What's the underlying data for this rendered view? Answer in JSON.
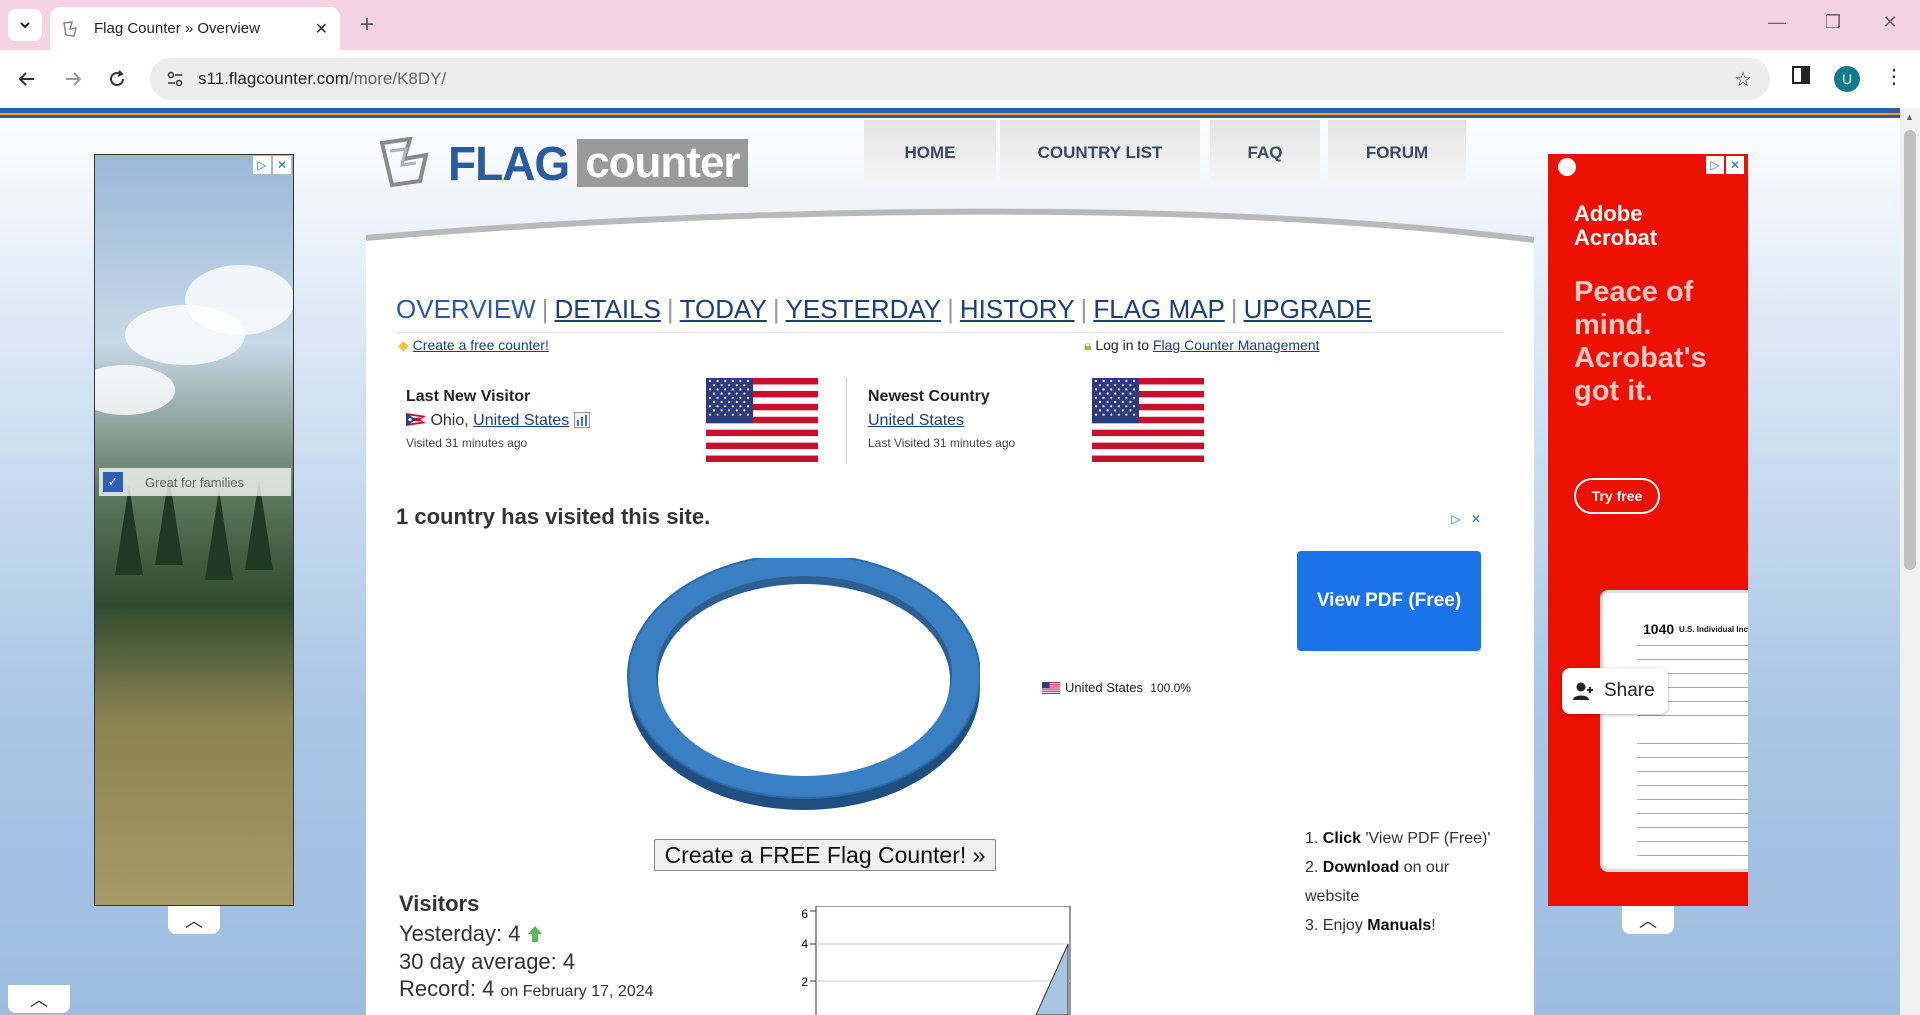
{
  "browser": {
    "tab_title": "Flag Counter » Overview",
    "url_domain": "s11.flagcounter.com",
    "url_path": "/more/K8DY/",
    "profile_initial": "U"
  },
  "nav": {
    "home": "HOME",
    "country_list": "COUNTRY LIST",
    "faq": "FAQ",
    "forum": "FORUM"
  },
  "logo": {
    "flag": "FLAG",
    "counter": "counter"
  },
  "subnav": {
    "overview": "OVERVIEW",
    "details": "DETAILS",
    "today": "TODAY",
    "yesterday": "YESTERDAY",
    "history": "HISTORY",
    "flag_map": "FLAG MAP",
    "upgrade": "UPGRADE",
    "separator": "|"
  },
  "links": {
    "create_free": "Create a free counter!",
    "login_prefix": "Log in to",
    "management": "Flag Counter Management"
  },
  "last_visitor": {
    "title": "Last New Visitor",
    "region": "Ohio,",
    "country": "United States",
    "visited": "Visited 31 minutes ago"
  },
  "newest_country": {
    "title": "Newest Country",
    "country": "United States",
    "visited": "Last Visited 31 minutes ago"
  },
  "summary": "1 country has visited this site.",
  "pie": {
    "label": "United States",
    "percent": "100.0%"
  },
  "create_button": "Create a FREE Flag Counter! »",
  "visitors": {
    "title": "Visitors",
    "yesterday_label": "Yesterday: 4",
    "avg_label": "30 day average: 4",
    "record_label": "Record: 4",
    "record_date": "on February 17, 2024",
    "chart_ticks": [
      "6",
      "4",
      "2"
    ]
  },
  "ads": {
    "left_caption": "Great for families",
    "right_brand_1": "Adobe",
    "right_brand_2": "Acrobat",
    "right_headline": "Peace of mind. Acrobat's got it.",
    "right_cta": "Try free",
    "right_share": "Share",
    "right_form_no": "1040",
    "right_form_title": "U.S. Individual Income",
    "view_pdf": "View PDF (Free)",
    "step1_b": "Click",
    "step1": " 'View PDF (Free)'",
    "step2_b": "Download",
    "step2": " on our website",
    "step3_a": "Enjoy ",
    "step3_b": "Manuals",
    "step3_c": "!"
  },
  "colors": {
    "brand_blue": "#2c5aa0",
    "pie_blue": "#3a7fc1",
    "ad_red": "#eb1000",
    "cta_blue": "#1a73e8"
  }
}
